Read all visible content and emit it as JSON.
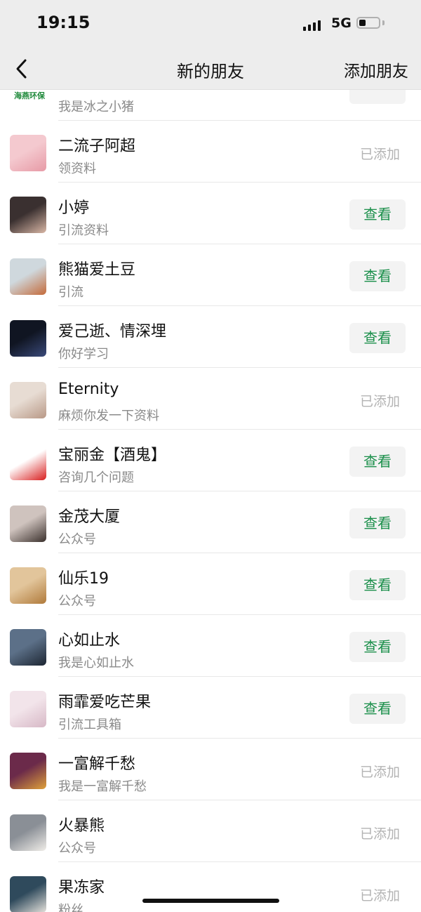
{
  "status_bar": {
    "time": "19:15",
    "network": "5G",
    "battery_level": 0.35
  },
  "nav": {
    "title": "新的朋友",
    "action_label": "添加朋友"
  },
  "partial_row": {
    "brand_text": "海燕环保",
    "message": "我是冰之小猪"
  },
  "requests": [
    {
      "name": "二流子阿超",
      "message": "领资料",
      "state": "已添加",
      "avatar_colors": [
        "#f4c9cf",
        "#e79aa6"
      ]
    },
    {
      "name": "小婷",
      "message": "引流资料",
      "state": "查看",
      "avatar_colors": [
        "#3a3030",
        "#d9b7a6"
      ]
    },
    {
      "name": "熊猫爱土豆",
      "message": "引流",
      "state": "查看",
      "avatar_colors": [
        "#cfd8dd",
        "#c46a3a"
      ]
    },
    {
      "name": "爱己逝、情深埋",
      "message": "你好学习",
      "state": "查看",
      "avatar_colors": [
        "#101522",
        "#3a4a7a"
      ]
    },
    {
      "name": "Eternity",
      "message": "麻烦你发一下资料",
      "state": "已添加",
      "avatar_colors": [
        "#e7dcd3",
        "#b89886"
      ]
    },
    {
      "name": "宝丽金【酒鬼】",
      "message": "咨询几个问题",
      "state": "查看",
      "avatar_colors": [
        "#ffffff",
        "#d81e1e"
      ]
    },
    {
      "name": "金茂大厦",
      "message": "公众号",
      "state": "查看",
      "avatar_colors": [
        "#cfc3be",
        "#3a302c"
      ]
    },
    {
      "name": "仙乐19",
      "message": "公众号",
      "state": "查看",
      "avatar_colors": [
        "#e2c59b",
        "#b07a3b"
      ]
    },
    {
      "name": "心如止水",
      "message": "我是心如止水",
      "state": "查看",
      "avatar_colors": [
        "#5c7088",
        "#1d2632"
      ]
    },
    {
      "name": "雨霏爱吃芒果",
      "message": "引流工具箱",
      "state": "查看",
      "avatar_colors": [
        "#f2e4ea",
        "#d7b8c6"
      ]
    },
    {
      "name": "一富解千愁",
      "message": "我是一富解千愁",
      "state": "已添加",
      "avatar_colors": [
        "#6b2a4a",
        "#e0a13a"
      ]
    },
    {
      "name": "火暴熊",
      "message": "公众号",
      "state": "已添加",
      "avatar_colors": [
        "#8a8f96",
        "#f1eee9"
      ]
    },
    {
      "name": "果冻家",
      "message": "粉丝",
      "state": "已添加",
      "avatar_colors": [
        "#2f4a5c",
        "#e6e2dc"
      ]
    }
  ]
}
